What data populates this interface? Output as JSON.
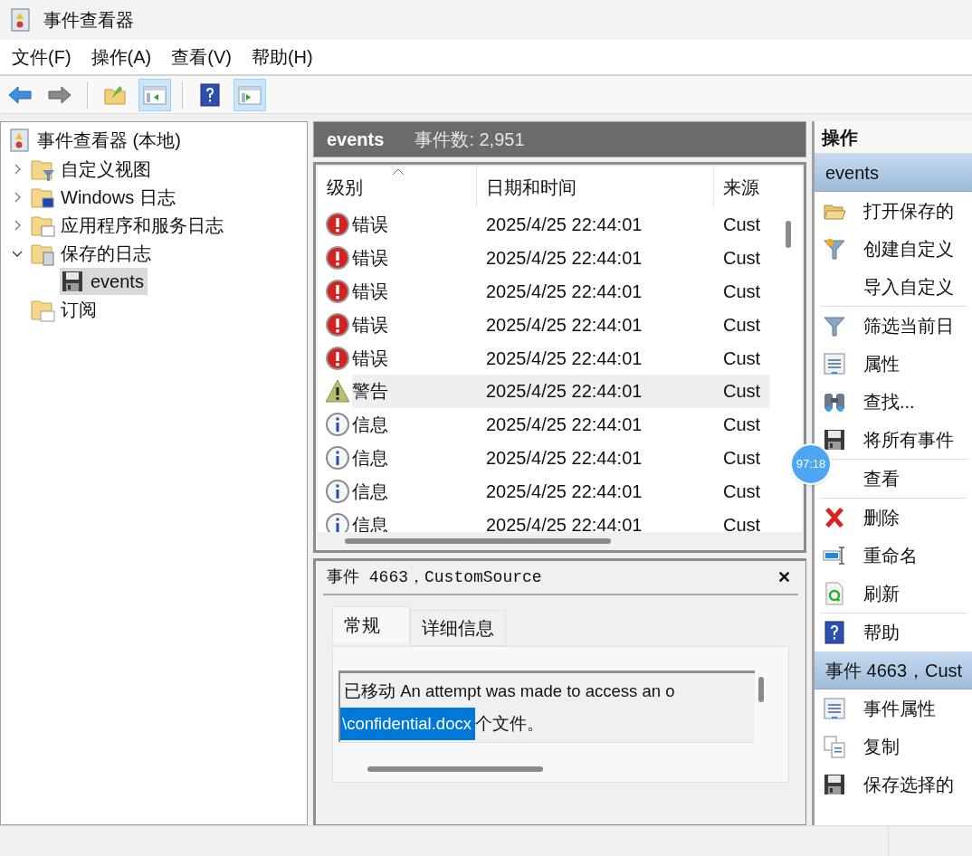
{
  "window": {
    "title": "事件查看器"
  },
  "menu": [
    "文件(F)",
    "操作(A)",
    "查看(V)",
    "帮助(H)"
  ],
  "toolbar": [
    {
      "kind": "back",
      "pressed": false
    },
    {
      "kind": "forward",
      "pressed": false
    },
    {
      "kind": "separator"
    },
    {
      "kind": "folder",
      "pressed": false
    },
    {
      "kind": "left-pane",
      "pressed": true
    },
    {
      "kind": "separator"
    },
    {
      "kind": "help",
      "pressed": false
    },
    {
      "kind": "right-pane",
      "pressed": true
    }
  ],
  "tree": {
    "label": "事件查看器 (本地)",
    "kind": "viewer",
    "children": [
      {
        "label": "自定义视图",
        "kind": "folder-filter",
        "expandable": true,
        "expanded": false,
        "selected": false
      },
      {
        "label": "Windows 日志",
        "kind": "folder-monitor",
        "expandable": true,
        "expanded": false,
        "selected": false
      },
      {
        "label": "应用程序和服务日志",
        "kind": "folder-window",
        "expandable": true,
        "expanded": false,
        "selected": false
      },
      {
        "label": "保存的日志",
        "kind": "folder-log",
        "expandable": true,
        "expanded": true,
        "selected": false,
        "children": [
          {
            "label": "events",
            "kind": "disk",
            "expandable": false,
            "selected": true
          }
        ]
      },
      {
        "label": "订阅",
        "kind": "folder-sub",
        "expandable": false,
        "selected": false
      }
    ]
  },
  "log": {
    "title": "events",
    "count": "事件数: 2,951",
    "columns": [
      "级别",
      "日期和时间",
      "来源"
    ],
    "rows": [
      {
        "kind": "error",
        "severity": "错误",
        "date": "2025/4/25 22:44:01",
        "source": "Cust",
        "highlighted": false
      },
      {
        "kind": "error",
        "severity": "错误",
        "date": "2025/4/25 22:44:01",
        "source": "Cust",
        "highlighted": false
      },
      {
        "kind": "error",
        "severity": "错误",
        "date": "2025/4/25 22:44:01",
        "source": "Cust",
        "highlighted": false
      },
      {
        "kind": "error",
        "severity": "错误",
        "date": "2025/4/25 22:44:01",
        "source": "Cust",
        "highlighted": false
      },
      {
        "kind": "error",
        "severity": "错误",
        "date": "2025/4/25 22:44:01",
        "source": "Cust",
        "highlighted": false
      },
      {
        "kind": "warning",
        "severity": "警告",
        "date": "2025/4/25 22:44:01",
        "source": "Cust",
        "highlighted": true
      },
      {
        "kind": "info",
        "severity": "信息",
        "date": "2025/4/25 22:44:01",
        "source": "Cust",
        "highlighted": false
      },
      {
        "kind": "info",
        "severity": "信息",
        "date": "2025/4/25 22:44:01",
        "source": "Cust",
        "highlighted": false
      },
      {
        "kind": "info",
        "severity": "信息",
        "date": "2025/4/25 22:44:01",
        "source": "Cust",
        "highlighted": false
      },
      {
        "kind": "info",
        "severity": "信息",
        "date": "2025/4/25 22:44:01",
        "source": "Cust",
        "highlighted": false
      }
    ]
  },
  "detail": {
    "title": "事件 4663，CustomSource",
    "close": "✕",
    "tabs": [
      {
        "label": "常规",
        "selected": true
      },
      {
        "label": "详细信息",
        "selected": false
      }
    ],
    "message": {
      "line": "已移动 An attempt was made to access an o",
      "selection": "\\confidential.docx",
      "after": "个文件。"
    }
  },
  "actions": {
    "title": "操作",
    "sections": [
      {
        "title": "events",
        "items": [
          {
            "label": "打开保存的",
            "kind": "open-folder",
            "divider_after": false
          },
          {
            "label": "创建自定义",
            "kind": "filter-new",
            "divider_after": false
          },
          {
            "label": "导入自定义",
            "kind": "plain",
            "divider_after": true
          },
          {
            "label": "筛选当前日",
            "kind": "filter",
            "divider_after": false
          },
          {
            "label": "属性",
            "kind": "properties",
            "divider_after": false
          },
          {
            "label": "查找...",
            "kind": "binoculars",
            "divider_after": false
          },
          {
            "label": "将所有事件",
            "kind": "disk",
            "divider_after": true
          },
          {
            "label": "查看",
            "kind": "plain",
            "divider_after": true
          },
          {
            "label": "删除",
            "kind": "delete",
            "divider_after": false
          },
          {
            "label": "重命名",
            "kind": "rename",
            "divider_after": false
          },
          {
            "label": "刷新",
            "kind": "refresh",
            "divider_after": true
          },
          {
            "label": "帮助",
            "kind": "help",
            "divider_after": false
          }
        ]
      },
      {
        "title": "事件 4663，Cust",
        "items": [
          {
            "label": "事件属性",
            "kind": "properties",
            "divider_after": false
          },
          {
            "label": "复制",
            "kind": "copy",
            "divider_after": false
          },
          {
            "label": "保存选择的",
            "kind": "disk",
            "divider_after": false
          }
        ]
      }
    ]
  },
  "overlay": {
    "time": "97:18"
  }
}
